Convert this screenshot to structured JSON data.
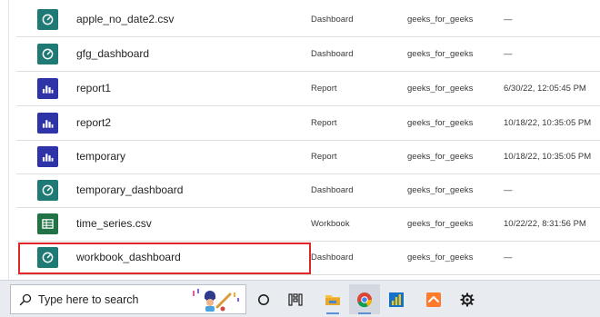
{
  "rows": [
    {
      "name": "apple_no_date2.csv",
      "type": "Dashboard",
      "owner": "geeks_for_geeks",
      "refreshed": "—",
      "icon": "dashboard-icon"
    },
    {
      "name": "gfg_dashboard",
      "type": "Dashboard",
      "owner": "geeks_for_geeks",
      "refreshed": "—",
      "icon": "dashboard-icon"
    },
    {
      "name": "report1",
      "type": "Report",
      "owner": "geeks_for_geeks",
      "refreshed": "6/30/22, 12:05:45 PM",
      "icon": "report-icon"
    },
    {
      "name": "report2",
      "type": "Report",
      "owner": "geeks_for_geeks",
      "refreshed": "10/18/22, 10:35:05 PM",
      "icon": "report-icon"
    },
    {
      "name": "temporary",
      "type": "Report",
      "owner": "geeks_for_geeks",
      "refreshed": "10/18/22, 10:35:05 PM",
      "icon": "report-icon"
    },
    {
      "name": "temporary_dashboard",
      "type": "Dashboard",
      "owner": "geeks_for_geeks",
      "refreshed": "—",
      "icon": "dashboard-icon"
    },
    {
      "name": "time_series.csv",
      "type": "Workbook",
      "owner": "geeks_for_geeks",
      "refreshed": "10/22/22, 8:31:56 PM",
      "icon": "workbook-icon"
    },
    {
      "name": "workbook_dashboard",
      "type": "Dashboard",
      "owner": "geeks_for_geeks",
      "refreshed": "—",
      "icon": "dashboard-icon"
    }
  ],
  "taskbar": {
    "search_placeholder": "Type here to search",
    "apps": [
      "cortana-icon",
      "task-view-icon",
      "file-explorer-icon",
      "chrome-icon",
      "power-bi-icon",
      "sublime-text-icon",
      "settings-icon"
    ]
  },
  "colors": {
    "dashboard": "#1f7a75",
    "report": "#2e34a8",
    "workbook": "#217346",
    "highlight": "#e0252b",
    "taskbar": "#e8ebf0"
  }
}
